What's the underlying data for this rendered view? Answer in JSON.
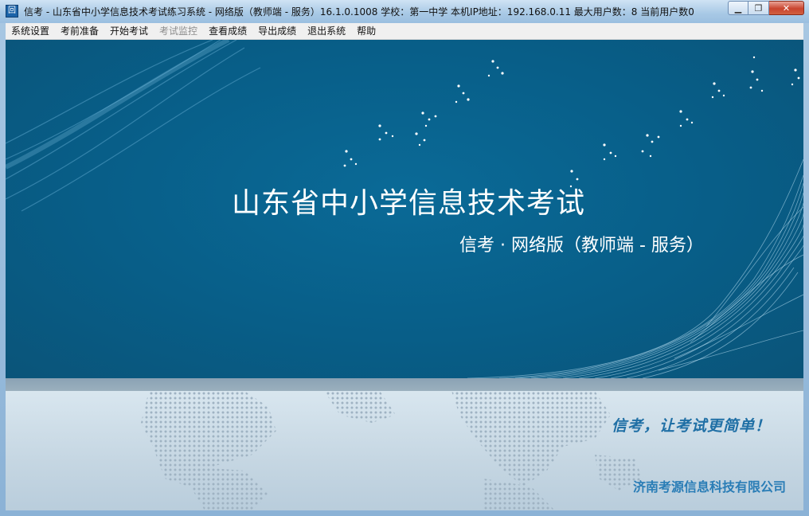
{
  "window": {
    "title": "信考 - 山东省中小学信息技术考试练习系统 - 网络版（教师端 - 服务）16.1.0.1008    学校：第一中学    本机IP地址：192.168.0.11    最大用户数：8    当前用户数0",
    "icon_glyph": "回"
  },
  "menu": {
    "items": [
      {
        "label": "系统设置"
      },
      {
        "label": "考前准备"
      },
      {
        "label": "开始考试"
      },
      {
        "label": "考试监控"
      },
      {
        "label": "查看成绩"
      },
      {
        "label": "导出成绩"
      },
      {
        "label": "退出系统"
      },
      {
        "label": "帮助"
      }
    ]
  },
  "banner": {
    "main_title": "山东省中小学信息技术考试",
    "sub_title": "信考 · 网络版（教师端 - 服务）",
    "slogan": "信考，让考试更简单！",
    "company": "济南考源信息科技有限公司"
  },
  "colors": {
    "banner_blue": "#085e88",
    "slogan_blue": "#1f6fa5",
    "company_blue": "#2a7db6"
  }
}
